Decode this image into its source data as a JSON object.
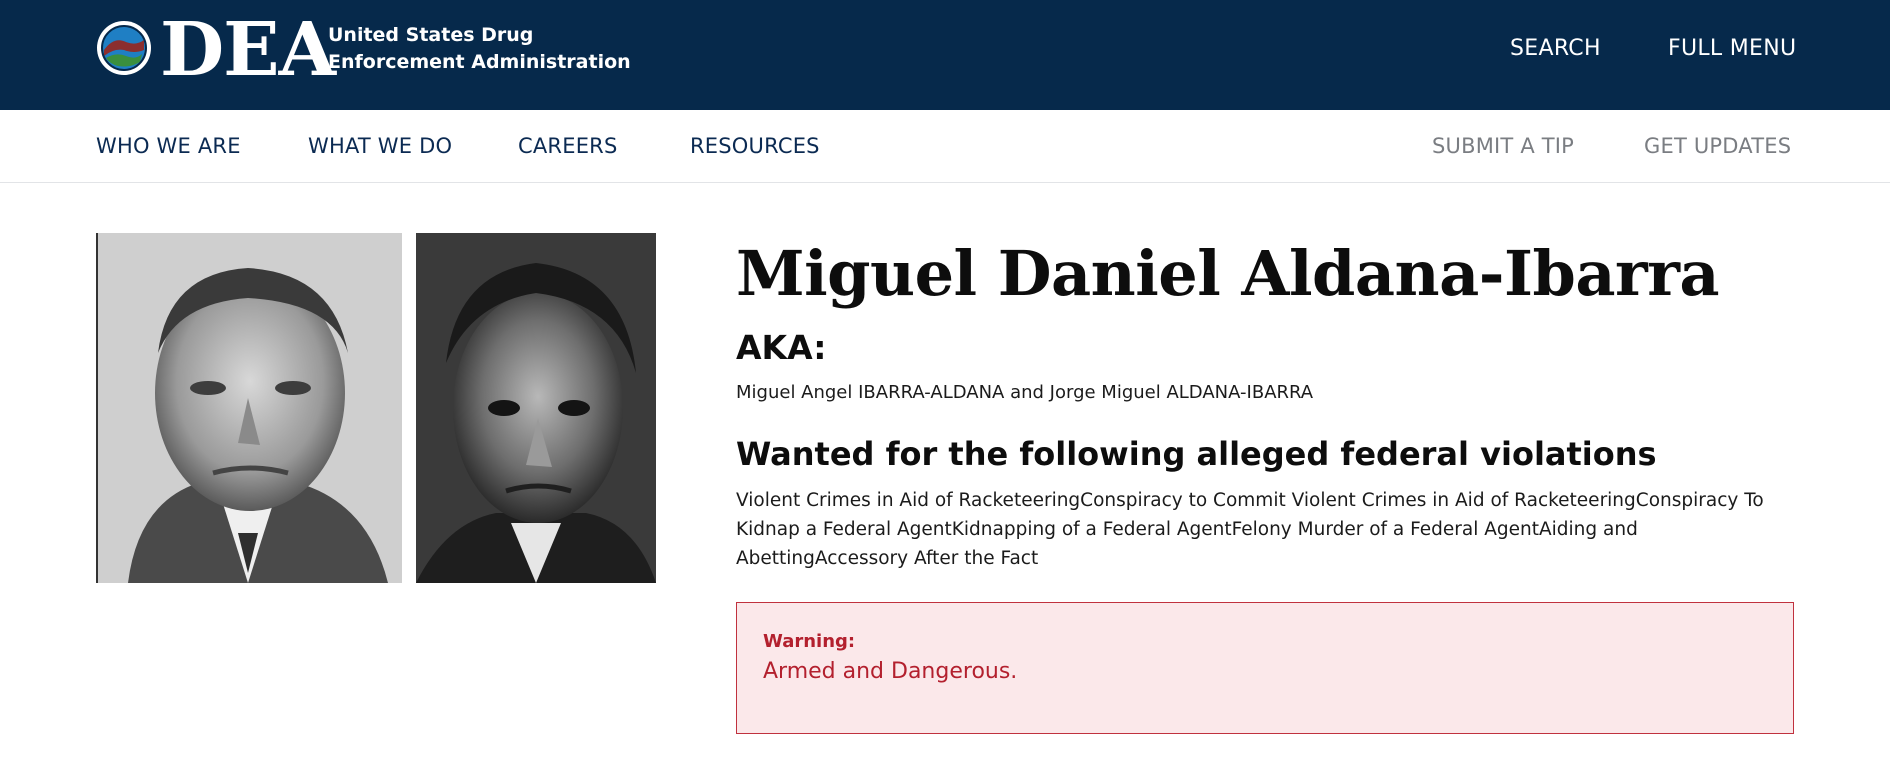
{
  "header": {
    "logo_text": "DEA",
    "agency_name": "United States Drug Enforcement Administration",
    "search_label": "SEARCH",
    "menu_label": "FULL MENU"
  },
  "nav": {
    "items": [
      "WHO WE ARE",
      "WHAT WE DO",
      "CAREERS",
      "RESOURCES"
    ],
    "submit_tip": "SUBMIT A TIP",
    "get_updates": "GET UPDATES"
  },
  "profile": {
    "name": "Miguel Daniel Aldana-Ibarra",
    "aka_heading": "AKA:",
    "aka": "Miguel Angel IBARRA-ALDANA and Jorge Miguel ALDANA-IBARRA",
    "violations_heading": "Wanted for the following alleged federal violations",
    "violations": "Violent Crimes in Aid of RacketeeringConspiracy to Commit Violent Crimes in Aid of RacketeeringConspiracy To Kidnap a Federal AgentKidnapping of a Federal AgentFelony Murder of a Federal AgentAiding and AbettingAccessory After the Fact",
    "warning_label": "Warning:",
    "warning_text": "Armed and Dangerous."
  },
  "colors": {
    "header_bg": "#06294b",
    "nav_text": "#0b2a52",
    "muted_nav": "#7a7d82",
    "warning_bg": "#fbe8ea",
    "warning_text": "#b3202e"
  }
}
